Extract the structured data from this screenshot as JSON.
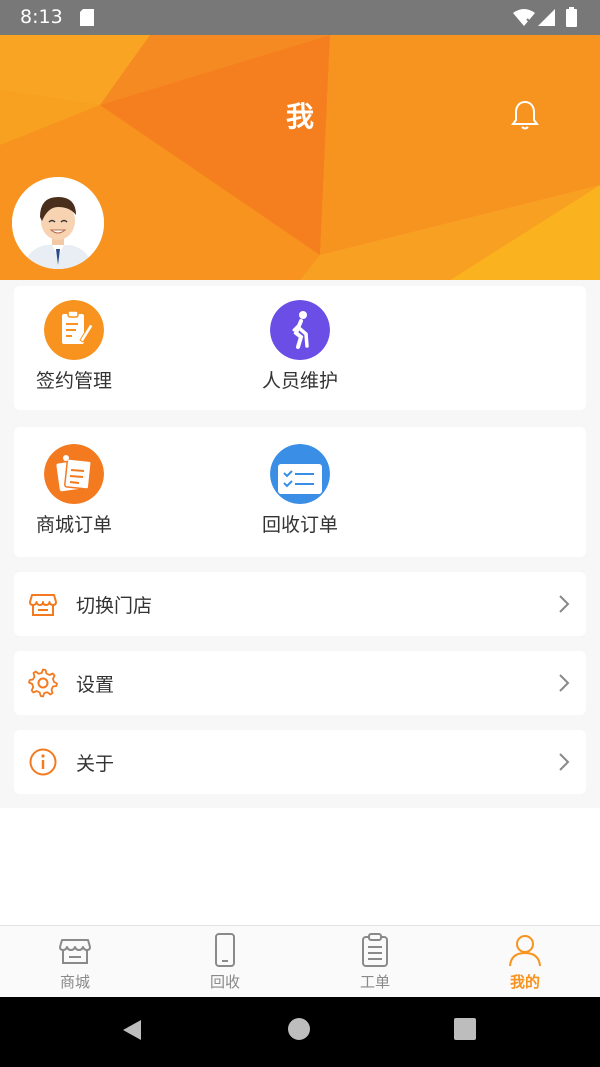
{
  "status_bar": {
    "time": "8:13"
  },
  "header": {
    "title": "我"
  },
  "icons": {
    "bell": "bell-icon",
    "avatar": "avatar-icon"
  },
  "grid_cards": [
    {
      "items": [
        {
          "label": "签约管理",
          "icon": "contract-icon",
          "color": "#f7931e"
        },
        {
          "label": "人员维护",
          "icon": "walking-person-icon",
          "color": "#6b4ee6"
        }
      ]
    },
    {
      "items": [
        {
          "label": "商城订单",
          "icon": "mall-order-icon",
          "color": "#f47a20"
        },
        {
          "label": "回收订单",
          "icon": "recycle-order-icon",
          "color": "#3a8ee6"
        }
      ]
    }
  ],
  "rows": [
    {
      "label": "切换门店",
      "icon": "store-icon"
    },
    {
      "label": "设置",
      "icon": "gear-icon"
    },
    {
      "label": "关于",
      "icon": "info-icon"
    }
  ],
  "tabbar": {
    "items": [
      {
        "label": "商城",
        "icon": "mall-icon",
        "active": false
      },
      {
        "label": "回收",
        "icon": "phone-icon",
        "active": false
      },
      {
        "label": "工单",
        "icon": "clipboard-icon",
        "active": false
      },
      {
        "label": "我的",
        "icon": "person-icon",
        "active": true
      }
    ]
  },
  "colors": {
    "accent": "#f7931e",
    "header_light": "#f9a21f",
    "header_dark": "#f47a20",
    "text": "#333333"
  }
}
